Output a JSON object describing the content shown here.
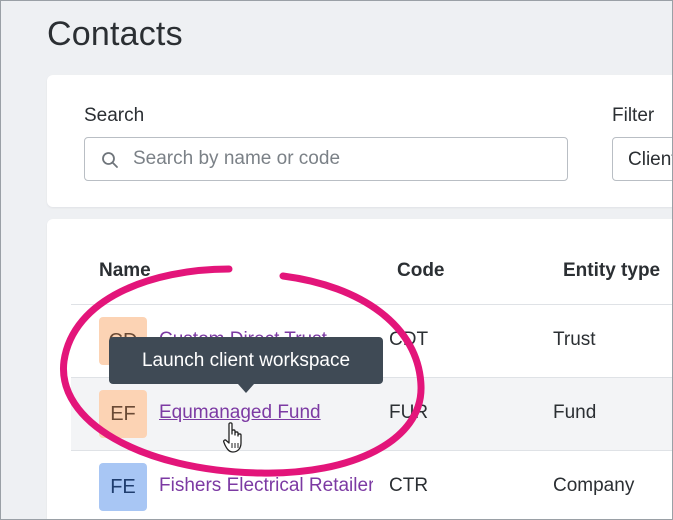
{
  "page": {
    "title": "Contacts"
  },
  "search": {
    "label": "Search",
    "placeholder": "Search by name or code",
    "value": ""
  },
  "filter": {
    "label": "Filter",
    "selected": "Clients"
  },
  "table": {
    "headers": {
      "name": "Name",
      "code": "Code",
      "entity_type": "Entity type"
    },
    "rows": [
      {
        "initials": "CD",
        "name": "Custom Direct Trust",
        "code": "CDT",
        "entity_type": "Trust",
        "avatar_color": "#fcd3b4"
      },
      {
        "initials": "EF",
        "name": "Equmanaged Fund",
        "code": "FUR",
        "entity_type": "Fund",
        "avatar_color": "#fcd3b4"
      },
      {
        "initials": "FE",
        "name": "Fishers Electrical Retailers",
        "code": "CTR",
        "entity_type": "Company",
        "avatar_color": "#a8c6f4"
      }
    ]
  },
  "tooltip": {
    "text": "Launch client workspace"
  },
  "colors": {
    "link": "#7c3aa3",
    "highlight_ring": "#e3157a",
    "tooltip_bg": "#3f4a55"
  },
  "icons": {
    "search": "search-icon",
    "cursor": "hand-pointer-icon"
  }
}
